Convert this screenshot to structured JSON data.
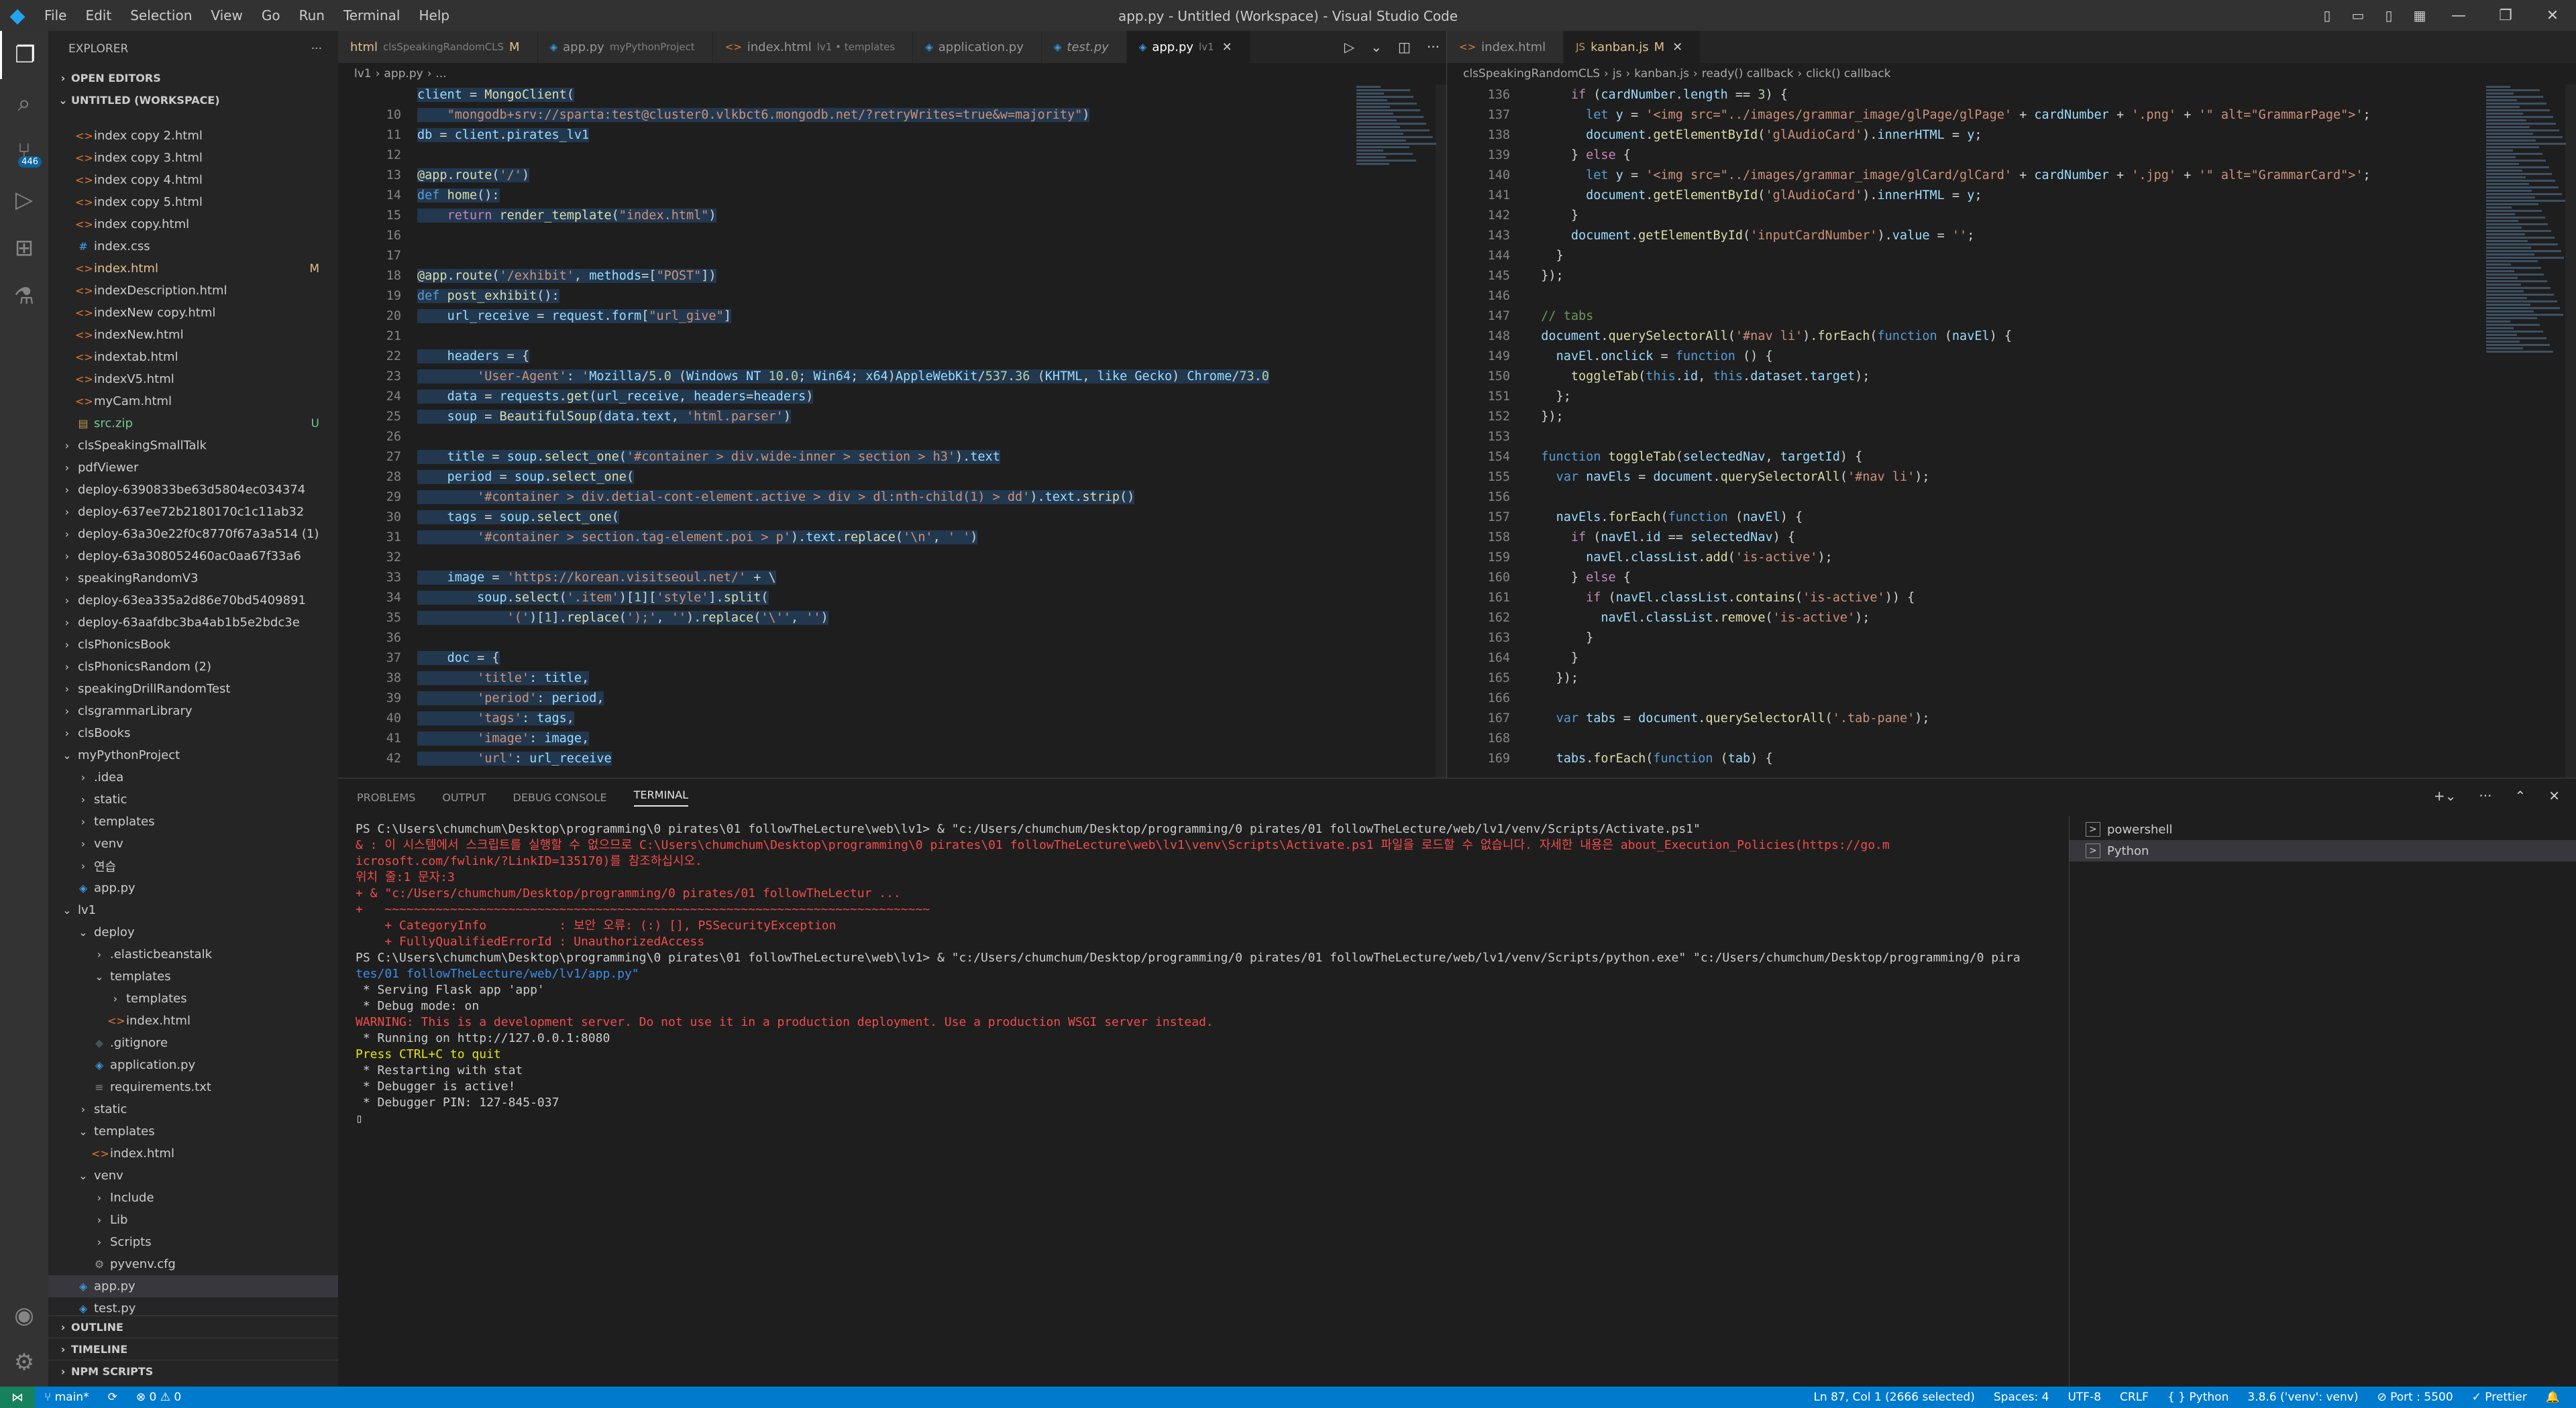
{
  "window": {
    "title": "app.py - Untitled (Workspace) - Visual Studio Code",
    "logo_icon": "vscode-logo-icon"
  },
  "menu": [
    "File",
    "Edit",
    "Selection",
    "View",
    "Go",
    "Run",
    "Terminal",
    "Help"
  ],
  "activity": {
    "source_control_badge": "446",
    "icons": [
      "files-icon",
      "search-icon",
      "source-control-icon",
      "run-debug-icon",
      "extensions-icon",
      "testing-icon"
    ],
    "bottom_icons": [
      "account-icon",
      "manage-gear-icon"
    ]
  },
  "sidebar": {
    "title": "EXPLORER",
    "open_editors": "OPEN EDITORS",
    "workspace": "UNTITLED (WORKSPACE)",
    "tree": [
      {
        "label": "index copy 2.html",
        "type": "html",
        "depth": 1
      },
      {
        "label": "index copy 3.html",
        "type": "html",
        "depth": 1
      },
      {
        "label": "index copy 4.html",
        "type": "html",
        "depth": 1
      },
      {
        "label": "index copy 5.html",
        "type": "html",
        "depth": 1
      },
      {
        "label": "index copy.html",
        "type": "html",
        "depth": 1
      },
      {
        "label": "index.css",
        "type": "css",
        "depth": 1
      },
      {
        "label": "index.html",
        "type": "html",
        "depth": 1,
        "status": "M",
        "color": "#e2c08d"
      },
      {
        "label": "indexDescription.html",
        "type": "html",
        "depth": 1
      },
      {
        "label": "indexNew copy.html",
        "type": "html",
        "depth": 1
      },
      {
        "label": "indexNew.html",
        "type": "html",
        "depth": 1
      },
      {
        "label": "indextab.html",
        "type": "html",
        "depth": 1
      },
      {
        "label": "indexV5.html",
        "type": "html",
        "depth": 1
      },
      {
        "label": "myCam.html",
        "type": "html",
        "depth": 1
      },
      {
        "label": "src.zip",
        "type": "zip",
        "depth": 1,
        "status": "U",
        "color": "#73c991"
      },
      {
        "label": "clsSpeakingSmallTalk",
        "type": "folder",
        "depth": 0
      },
      {
        "label": "pdfViewer",
        "type": "folder",
        "depth": 0
      },
      {
        "label": "deploy-6390833be63d5804ec034374",
        "type": "folder",
        "depth": 0
      },
      {
        "label": "deploy-637ee72b2180170c1c11ab32",
        "type": "folder",
        "depth": 0
      },
      {
        "label": "deploy-63a30e22f0c8770f67a3a514 (1)",
        "type": "folder",
        "depth": 0
      },
      {
        "label": "deploy-63a308052460ac0aa67f33a6",
        "type": "folder",
        "depth": 0
      },
      {
        "label": "speakingRandomV3",
        "type": "folder",
        "depth": 0
      },
      {
        "label": "deploy-63ea335a2d86e70bd5409891",
        "type": "folder",
        "depth": 0
      },
      {
        "label": "deploy-63aafdbc3ba4ab1b5e2bdc3e",
        "type": "folder",
        "depth": 0
      },
      {
        "label": "clsPhonicsBook",
        "type": "folder",
        "depth": 0
      },
      {
        "label": "clsPhonicsRandom (2)",
        "type": "folder",
        "depth": 0
      },
      {
        "label": "speakingDrillRandomTest",
        "type": "folder",
        "depth": 0
      },
      {
        "label": "clsgrammarLibrary",
        "type": "folder",
        "depth": 0
      },
      {
        "label": "clsBooks",
        "type": "folder",
        "depth": 0
      },
      {
        "label": "myPythonProject",
        "type": "folder-open",
        "depth": 0
      },
      {
        "label": ".idea",
        "type": "folder",
        "depth": 1
      },
      {
        "label": "static",
        "type": "folder",
        "depth": 1
      },
      {
        "label": "templates",
        "type": "folder",
        "depth": 1
      },
      {
        "label": "venv",
        "type": "folder",
        "depth": 1
      },
      {
        "label": "연습",
        "type": "folder",
        "depth": 1
      },
      {
        "label": "app.py",
        "type": "py",
        "depth": 1
      },
      {
        "label": "lv1",
        "type": "folder-open",
        "depth": 0
      },
      {
        "label": "deploy",
        "type": "folder-open",
        "depth": 1
      },
      {
        "label": ".elasticbeanstalk",
        "type": "folder",
        "depth": 2
      },
      {
        "label": "templates",
        "type": "folder-open",
        "depth": 2
      },
      {
        "label": "templates",
        "type": "folder",
        "depth": 3
      },
      {
        "label": "index.html",
        "type": "html",
        "depth": 3
      },
      {
        "label": ".gitignore",
        "type": "git",
        "depth": 2
      },
      {
        "label": "application.py",
        "type": "py",
        "depth": 2
      },
      {
        "label": "requirements.txt",
        "type": "txt",
        "depth": 2
      },
      {
        "label": "static",
        "type": "folder",
        "depth": 1
      },
      {
        "label": "templates",
        "type": "folder-open",
        "depth": 1
      },
      {
        "label": "index.html",
        "type": "html",
        "depth": 2
      },
      {
        "label": "venv",
        "type": "folder-open",
        "depth": 1
      },
      {
        "label": "Include",
        "type": "folder",
        "depth": 2
      },
      {
        "label": "Lib",
        "type": "folder",
        "depth": 2
      },
      {
        "label": "Scripts",
        "type": "folder",
        "depth": 2
      },
      {
        "label": "pyvenv.cfg",
        "type": "cfg",
        "depth": 2
      },
      {
        "label": "app.py",
        "type": "py",
        "depth": 1,
        "selected": true
      },
      {
        "label": "test.py",
        "type": "py",
        "depth": 1
      }
    ],
    "outline": "OUTLINE",
    "timeline": "TIMELINE",
    "npm": "NPM SCRIPTS"
  },
  "editor1": {
    "tabs": [
      {
        "label": "html",
        "sub": "clsSpeakingRandomCLS",
        "mark": "M",
        "icon": ""
      },
      {
        "label": "app.py",
        "sub": "myPythonProject",
        "icon": "py"
      },
      {
        "label": "index.html",
        "sub": "lv1 • templates",
        "icon": "html"
      },
      {
        "label": "application.py",
        "sub": "",
        "icon": "py"
      },
      {
        "label": "test.py",
        "sub": "",
        "icon": "py",
        "italic": true
      },
      {
        "label": "app.py",
        "sub": "lv1",
        "icon": "py",
        "active": true,
        "close": "✕"
      }
    ],
    "breadcrumb": [
      "lv1",
      "›",
      "app.py",
      "›",
      "..."
    ],
    "lines": [
      {
        "n": "",
        "html": "client = MongoClient("
      },
      {
        "n": "10",
        "html": "    \"mongodb+srv://sparta:test@cluster0.vlkbct6.mongodb.net/?retryWrites=true&w=majority\")"
      },
      {
        "n": "11",
        "html": "db = client.pirates_lv1"
      },
      {
        "n": "12",
        "html": ""
      },
      {
        "n": "13",
        "html": "@app.route('/')"
      },
      {
        "n": "14",
        "html": "def home():"
      },
      {
        "n": "15",
        "html": "    return render_template(\"index.html\")"
      },
      {
        "n": "16",
        "html": ""
      },
      {
        "n": "17",
        "html": ""
      },
      {
        "n": "18",
        "html": "@app.route('/exhibit', methods=[\"POST\"])"
      },
      {
        "n": "19",
        "html": "def post_exhibit():"
      },
      {
        "n": "20",
        "html": "    url_receive = request.form[\"url_give\"]"
      },
      {
        "n": "21",
        "html": ""
      },
      {
        "n": "22",
        "html": "    headers = {"
      },
      {
        "n": "23",
        "html": "        'User-Agent': 'Mozilla/5.0 (Windows NT 10.0; Win64; x64)AppleWebKit/537.36 (KHTML, like Gecko) Chrome/73.0"
      },
      {
        "n": "24",
        "html": "    data = requests.get(url_receive, headers=headers)"
      },
      {
        "n": "25",
        "html": "    soup = BeautifulSoup(data.text, 'html.parser')"
      },
      {
        "n": "26",
        "html": ""
      },
      {
        "n": "27",
        "html": "    title = soup.select_one('#container > div.wide-inner > section > h3').text"
      },
      {
        "n": "28",
        "html": "    period = soup.select_one("
      },
      {
        "n": "29",
        "html": "        '#container > div.detial-cont-element.active > div > dl:nth-child(1) > dd').text.strip()"
      },
      {
        "n": "30",
        "html": "    tags = soup.select_one("
      },
      {
        "n": "31",
        "html": "        '#container > section.tag-element.poi > p').text.replace('\\n', ' ')"
      },
      {
        "n": "32",
        "html": ""
      },
      {
        "n": "33",
        "html": "    image = 'https://korean.visitseoul.net/' + \\"
      },
      {
        "n": "34",
        "html": "        soup.select('.item')[1]['style'].split("
      },
      {
        "n": "35",
        "html": "            '(')[1].replace(');', '').replace('\\'', '')"
      },
      {
        "n": "36",
        "html": ""
      },
      {
        "n": "37",
        "html": "    doc = {"
      },
      {
        "n": "38",
        "html": "        'title': title,"
      },
      {
        "n": "39",
        "html": "        'period': period,"
      },
      {
        "n": "40",
        "html": "        'tags': tags,"
      },
      {
        "n": "41",
        "html": "        'image': image,"
      },
      {
        "n": "42",
        "html": "        'url': url_receive"
      }
    ]
  },
  "editor2": {
    "tabs": [
      {
        "label": "index.html",
        "icon": "html"
      },
      {
        "label": "kanban.js",
        "mark": "M",
        "icon": "js",
        "active": true,
        "close": "✕"
      }
    ],
    "breadcrumb": [
      "clsSpeakingRandomCLS",
      "›",
      "js",
      "›",
      "kanban.js",
      "›",
      "ready() callback",
      "›",
      "click() callback"
    ],
    "lines": [
      {
        "n": "136",
        "t": "      if (cardNumber.length == 3) {"
      },
      {
        "n": "137",
        "t": "        let y = '<img src=\"../images/grammar_image/glPage/glPage' + cardNumber + '.png' + '\" alt=\"GrammarPage\">';"
      },
      {
        "n": "138",
        "t": "        document.getElementById('glAudioCard').innerHTML = y;"
      },
      {
        "n": "139",
        "t": "      } else {"
      },
      {
        "n": "140",
        "t": "        let y = '<img src=\"../images/grammar_image/glCard/glCard' + cardNumber + '.jpg' + '\" alt=\"GrammarCard\">';"
      },
      {
        "n": "141",
        "t": "        document.getElementById('glAudioCard').innerHTML = y;"
      },
      {
        "n": "142",
        "t": "      }"
      },
      {
        "n": "143",
        "t": "      document.getElementById('inputCardNumber').value = '';"
      },
      {
        "n": "144",
        "t": "    }"
      },
      {
        "n": "145",
        "t": "  });"
      },
      {
        "n": "146",
        "t": ""
      },
      {
        "n": "147",
        "t": "  // tabs"
      },
      {
        "n": "148",
        "t": "  document.querySelectorAll('#nav li').forEach(function (navEl) {"
      },
      {
        "n": "149",
        "t": "    navEl.onclick = function () {"
      },
      {
        "n": "150",
        "t": "      toggleTab(this.id, this.dataset.target);"
      },
      {
        "n": "151",
        "t": "    };"
      },
      {
        "n": "152",
        "t": "  });"
      },
      {
        "n": "153",
        "t": ""
      },
      {
        "n": "154",
        "t": "  function toggleTab(selectedNav, targetId) {"
      },
      {
        "n": "155",
        "t": "    var navEls = document.querySelectorAll('#nav li');"
      },
      {
        "n": "156",
        "t": ""
      },
      {
        "n": "157",
        "t": "    navEls.forEach(function (navEl) {"
      },
      {
        "n": "158",
        "t": "      if (navEl.id == selectedNav) {"
      },
      {
        "n": "159",
        "t": "        navEl.classList.add('is-active');"
      },
      {
        "n": "160",
        "t": "      } else {"
      },
      {
        "n": "161",
        "t": "        if (navEl.classList.contains('is-active')) {"
      },
      {
        "n": "162",
        "t": "          navEl.classList.remove('is-active');"
      },
      {
        "n": "163",
        "t": "        }"
      },
      {
        "n": "164",
        "t": "      }"
      },
      {
        "n": "165",
        "t": "    });"
      },
      {
        "n": "166",
        "t": ""
      },
      {
        "n": "167",
        "t": "    var tabs = document.querySelectorAll('.tab-pane');"
      },
      {
        "n": "168",
        "t": ""
      },
      {
        "n": "169",
        "t": "    tabs.forEach(function (tab) {"
      }
    ]
  },
  "panel": {
    "tabs": [
      "PROBLEMS",
      "OUTPUT",
      "DEBUG CONSOLE",
      "TERMINAL"
    ],
    "terminal_lines": [
      {
        "c": "",
        "t": "PS C:\\Users\\chumchum\\Desktop\\programming\\0 pirates\\01 followTheLecture\\web\\lv1> & \"c:/Users/chumchum/Desktop/programming/0 pirates/01 followTheLecture/web/lv1/venv/Scripts/Activate.ps1\""
      },
      {
        "c": "t-red",
        "t": "& : 이 시스템에서 스크립트를 실행할 수 없으므로 C:\\Users\\chumchum\\Desktop\\programming\\0 pirates\\01 followTheLecture\\web\\lv1\\venv\\Scripts\\Activate.ps1 파일을 로드할 수 없습니다. 자세한 내용은 about_Execution_Policies(https://go.m"
      },
      {
        "c": "t-red",
        "t": "icrosoft.com/fwlink/?LinkID=135170)를 참조하십시오."
      },
      {
        "c": "t-red",
        "t": "위치 줄:1 문자:3"
      },
      {
        "c": "t-red",
        "t": "+ & \"c:/Users/chumchum/Desktop/programming/0 pirates/01 followTheLectur ..."
      },
      {
        "c": "t-red",
        "t": "+   ~~~~~~~~~~~~~~~~~~~~~~~~~~~~~~~~~~~~~~~~~~~~~~~~~~~~~~~~~~~~~~~~~~~~~~~~~~~"
      },
      {
        "c": "t-red",
        "t": "    + CategoryInfo          : 보안 오류: (:) [], PSSecurityException"
      },
      {
        "c": "t-red",
        "t": "    + FullyQualifiedErrorId : UnauthorizedAccess"
      },
      {
        "c": "",
        "t": "PS C:\\Users\\chumchum\\Desktop\\programming\\0 pirates\\01 followTheLecture\\web\\lv1> & \"c:/Users/chumchum/Desktop/programming/0 pirates/01 followTheLecture/web/lv1/venv/Scripts/python.exe\" \"c:/Users/chumchum/Desktop/programming/0 pira"
      },
      {
        "c": "t-path",
        "t": "tes/01 followTheLecture/web/lv1/app.py\""
      },
      {
        "c": "",
        "t": " * Serving Flask app 'app'"
      },
      {
        "c": "",
        "t": " * Debug mode: on"
      },
      {
        "c": "t-red",
        "t": "WARNING: This is a development server. Do not use it in a production deployment. Use a production WSGI server instead."
      },
      {
        "c": "",
        "t": " * Running on http://127.0.0.1:8080"
      },
      {
        "c": "t-yel",
        "t": "Press CTRL+C to quit"
      },
      {
        "c": "",
        "t": " * Restarting with stat"
      },
      {
        "c": "",
        "t": " * Debugger is active!"
      },
      {
        "c": "",
        "t": " * Debugger PIN: 127-845-037"
      },
      {
        "c": "",
        "t": "▯"
      }
    ],
    "terminals": [
      "powershell",
      "Python"
    ]
  },
  "status": {
    "branch": "main*",
    "sync": "⟳",
    "errors": "⊗ 0",
    "warnings": "⚠ 0",
    "position": "Ln 87, Col 1 (2666 selected)",
    "spaces": "Spaces: 4",
    "encoding": "UTF-8",
    "eol": "CRLF",
    "language": "Python",
    "interpreter": "3.8.6 ('venv': venv)",
    "port": "Port : 5500",
    "prettier": "✓ Prettier",
    "colors": {
      "bar": "#007acc",
      "remote": "#16825d"
    }
  }
}
